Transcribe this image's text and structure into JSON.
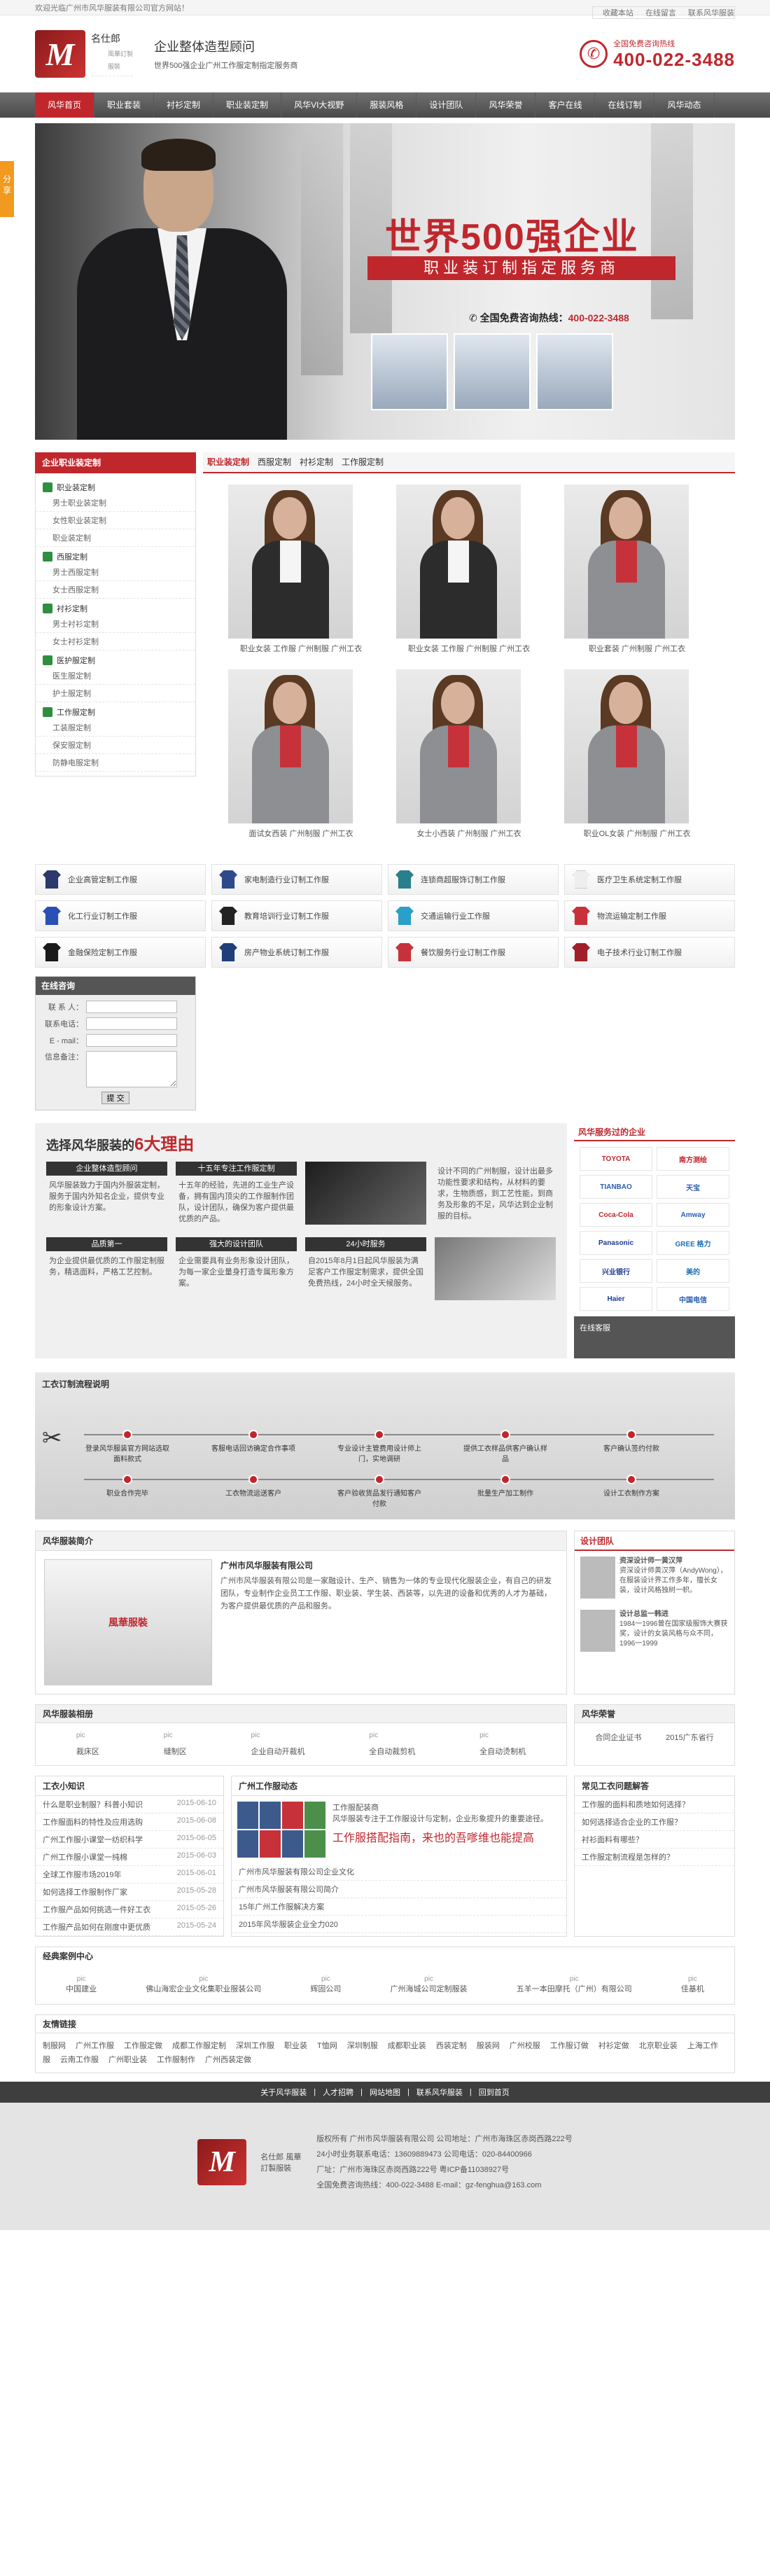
{
  "topbar": {
    "welcome": "欢迎光临广州市风华服装有限公司官方网站！",
    "links": [
      "收藏本站",
      "在线留言",
      "联系风华服装"
    ]
  },
  "header": {
    "logo_mark": "M",
    "logo_name": "名仕郎",
    "logo_sub": "風華訂製服裝",
    "slogan1": "企业整体造型顾问",
    "slogan2": "世界500强企业广州工作服定制指定服务商",
    "hotline_label": "全国免费咨询热线",
    "hotline": "400-022-3488"
  },
  "nav": [
    "风华首页",
    "职业套装",
    "衬衫定制",
    "职业装定制",
    "风华VI大视野",
    "服装风格",
    "设计团队",
    "风华荣誉",
    "客户在线",
    "在线订制",
    "风华动态"
  ],
  "banner": {
    "headline": "世界500强企业",
    "strip": "职业装订制指定服务商",
    "phone_label": "全国免费咨询热线：",
    "phone": "400-022-3488"
  },
  "sidebar": {
    "title": "企业职业装定制",
    "groups": [
      {
        "name": "职业装定制",
        "items": [
          "男士职业装定制",
          "女性职业装定制",
          "职业装定制"
        ]
      },
      {
        "name": "西服定制",
        "items": [
          "男士西服定制",
          "女士西服定制"
        ]
      },
      {
        "name": "衬衫定制",
        "items": [
          "男士衬衫定制",
          "女士衬衫定制"
        ]
      },
      {
        "name": "医护服定制",
        "items": [
          "医生服定制",
          "护士服定制"
        ]
      },
      {
        "name": "工作服定制",
        "items": [
          "工装服定制",
          "保安服定制",
          "防静电服定制"
        ]
      }
    ]
  },
  "products": {
    "tabs": [
      "职业装定制",
      "西服定制",
      "衬衫定制",
      "工作服定制"
    ],
    "items": [
      "职业女装 工作服 广州制服 广州工衣",
      "职业女装 工作服 广州制服 广州工衣",
      "职业套装 广州制服 广州工衣",
      "面试女西装 广州制服 广州工衣",
      "女士小西装 广州制服 广州工衣",
      "职业OL女装 广州制服 广州工衣"
    ]
  },
  "categories": [
    "企业高管定制工作服",
    "家电制造行业订制工作服",
    "连锁商超服饰订制工作服",
    "医疗卫生系统定制工作服",
    "化工行业订制工作服",
    "教育培训行业订制工作服",
    "交通运输行业工作服",
    "物流运输定制工作服",
    "金融保险定制工作服",
    "房产物业系统订制工作服",
    "餐饮服务行业订制工作服",
    "电子技术行业订制工作服"
  ],
  "contact": {
    "title": "在线咨询",
    "name": "联 系 人：",
    "phone": "联系电话：",
    "email": "E - mail：",
    "msg": "信息备注：",
    "submit": "提 交"
  },
  "reasons": {
    "title": "选择风华服装的",
    "title_em": "6大理由",
    "cells": [
      {
        "head": "企业整体造型顾问",
        "text": "风华服装致力于国内外服装定制，服务于国内外知名企业，提供专业的形象设计方案。"
      },
      {
        "head": "十五年专注工作服定制",
        "text": "十五年的经验，先进的工业生产设备，拥有国内顶尖的工作服制作团队，设计团队，确保为客户提供最优质的产品。"
      },
      {
        "head": "",
        "text": ""
      },
      {
        "head": "",
        "text": "设计不同的广州制服，设计出最多功能性要求和结构，从材料的要求，生物质感，到工艺性能，到商务及形象的不足，风华达到企业制服的目标。"
      },
      {
        "head": "品质第一",
        "text": "为企业提供最优质的工作服定制服务，精选面料，严格工艺控制。"
      },
      {
        "head": "强大的设计团队",
        "text": "企业需要具有业务形象设计团队，为每一家企业量身打造专属形象方案。"
      },
      {
        "head": "24小时服务",
        "text": "自2015年8月1日起风华服装为满足客户工作服定制需求，提供全国免费热线，24小时全天候服务。"
      },
      {
        "head": "",
        "text": ""
      }
    ]
  },
  "clients": {
    "title": "风华服务过的企业",
    "logos": [
      "TOYOTA",
      "南方测绘",
      "TIANBAO",
      "天宝",
      "Coca-Cola",
      "Amway",
      "Panasonic",
      "GREE 格力",
      "兴业银行",
      "美的",
      "Haier",
      "中国电信"
    ],
    "online": "在线客服"
  },
  "process": {
    "title": "工衣订制流程说明",
    "steps_top": [
      "登录风华服装官方网站选取面料款式",
      "客服电话回访确定合作事项",
      "专业设计主管费用设计师上门，实地调研",
      "提供工衣样品供客户确认样品",
      "客户确认签约付款"
    ],
    "steps_bottom": [
      "职业合作完毕",
      "工衣物流运送客户",
      "客户验收货品发行通知客户付款",
      "批量生产加工制作",
      "设计工衣制作方案"
    ]
  },
  "about": {
    "title": "风华服装简介",
    "heading": "广州市风华服装有限公司",
    "text": "广州市风华服装有限公司是一家融设计、生产、销售为一体的专业现代化服装企业，有自己的研发团队，专业制作企业员工工作服、职业装、学生装、西装等，以先进的设备和优秀的人才为基础，为客户提供最优质的产品和服务。",
    "pic_label": "風華服裝"
  },
  "team": {
    "title": "设计团队",
    "members": [
      {
        "name": "资深设计师一黄汉萍",
        "text": "资深设计师黄汉萍（AndyWong），在服装设计界工作多年，擅长女装，设计风格独树一帜。"
      },
      {
        "name": "设计总监一韩进",
        "text": "1984一1996曾在国家级服饰大赛获奖，设计的女装风格与众不同，1996一1999"
      }
    ]
  },
  "gallery": {
    "title": "风华服装相册",
    "items": [
      "裁床区",
      "缝制区",
      "企业自动开裁机",
      "全自动裁剪机",
      "全自动烫制机"
    ],
    "pic": "pic"
  },
  "honor": {
    "title": "风华荣誉",
    "items": [
      "合同企业证书",
      "2015广东省行"
    ]
  },
  "news1": {
    "title": "工衣小知识",
    "items": [
      {
        "t": "什么是职业制服？科普小知识",
        "d": "2015-06-10"
      },
      {
        "t": "工作服面料的特性及应用选购",
        "d": "2015-06-08"
      },
      {
        "t": "广州工作服小课堂一纺织科学",
        "d": "2015-06-05"
      },
      {
        "t": "广州工作服小课堂一纯棉",
        "d": "2015-06-03"
      },
      {
        "t": "全球工作服市场2019年",
        "d": "2015-06-01"
      },
      {
        "t": "如何选择工作服制作厂家",
        "d": "2015-05-28"
      },
      {
        "t": "工作服产品如何挑选一件好工衣",
        "d": "2015-05-26"
      },
      {
        "t": "工作服产品如何在刚度中更优质",
        "d": "2015-05-24"
      }
    ]
  },
  "news2": {
    "title": "广州工作服动态",
    "head": "工作服配装商",
    "text": "风华服装专注于工作服设计与定制，企业形象提升的重要途径。",
    "promo": "工作服搭配指南，来也的吾嗲维也能提高",
    "items": [
      "广州市风华服装有限公司企业文化",
      "广州市风华服装有限公司简介",
      "15年广州工作服解决方案",
      "2015年风华服装企业全力020"
    ]
  },
  "faq": {
    "title": "常见工衣问题解答",
    "items": [
      "工作服的面料和质地如何选择？",
      "如何选择适合企业的工作服？",
      "衬衫面料有哪些？",
      "工作服定制流程是怎样的？"
    ]
  },
  "cases": {
    "title": "经典案例中心",
    "items": [
      "中国建业",
      "佛山海宏企业文化集职业服装公司",
      "辉固公司",
      "广州海城公司定制服装",
      "五羊一本田摩托（广州）有限公司",
      "佳基机"
    ],
    "pic": "pic"
  },
  "links": {
    "title": "友情链接",
    "items": [
      "制服网",
      "广州工作服",
      "工作服定做",
      "成都工作服定制",
      "深圳工作服",
      "职业装",
      "T恤网",
      "深圳制服",
      "成都职业装",
      "西装定制",
      "服装网",
      "广州校服",
      "工作服订做",
      "衬衫定做",
      "北京职业装",
      "上海工作服",
      "云南工作服",
      "广州职业装",
      "工作服制作",
      "广州西装定做"
    ]
  },
  "footer": {
    "nav": [
      "关于风华服装",
      "人才招聘",
      "网站地图",
      "联系风华服装",
      "回到首页"
    ],
    "logo_mark": "M",
    "logo_name": "名仕郎 風華訂製服裝",
    "lines": [
      "版权所有 广州市风华服装有限公司   公司地址：广州市海珠区赤岗西路222号",
      "24小时业务联系电话：13609889473   公司电话：020-84400966",
      "厂址：广州市海珠区赤岗西路222号   粤ICP备11038927号",
      "全国免费咨询热线：400-022-3488   E-mail：gz-fenghua@163.com"
    ]
  },
  "share": "分享"
}
